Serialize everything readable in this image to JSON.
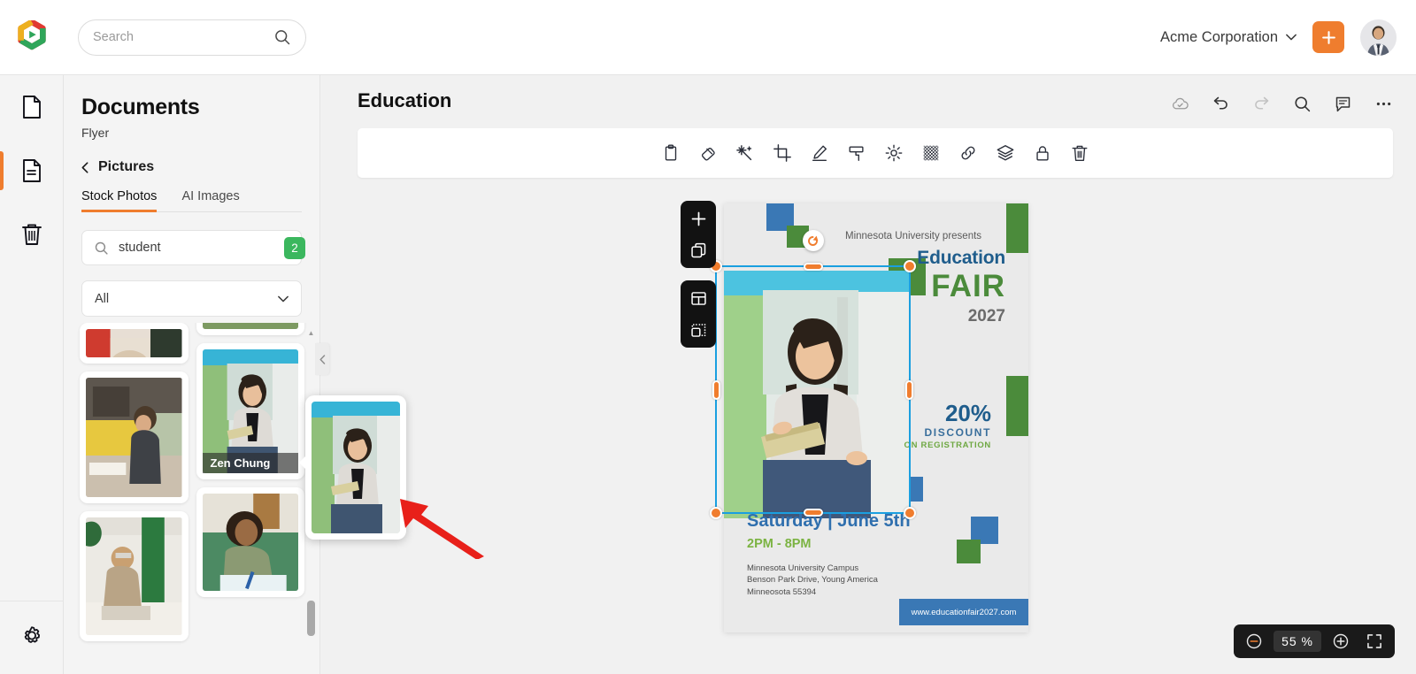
{
  "app": {
    "logo_name": "brand-logo"
  },
  "topbar": {
    "search_placeholder": "Search",
    "org_name": "Acme Corporation",
    "add_label": "+"
  },
  "rail": {
    "items": [
      {
        "name": "documents",
        "icon": "file-icon",
        "active": false
      },
      {
        "name": "pages",
        "icon": "file-lines-icon",
        "active": true
      },
      {
        "name": "trash",
        "icon": "trash-icon",
        "active": false
      }
    ],
    "settings": {
      "name": "settings",
      "icon": "gear-icon"
    }
  },
  "panel": {
    "title": "Documents",
    "subtitle": "Flyer",
    "breadcrumb": "Pictures",
    "tabs": [
      {
        "label": "Stock Photos",
        "active": true
      },
      {
        "label": "AI Images",
        "active": false
      }
    ],
    "filter": {
      "value": "student",
      "count_badge": "2"
    },
    "category": {
      "value": "All"
    },
    "thumbnails": [
      {
        "id": "t1",
        "label": ""
      },
      {
        "id": "t2",
        "label": ""
      },
      {
        "id": "t3",
        "label": ""
      },
      {
        "id": "t4",
        "label": "Zen Chung"
      },
      {
        "id": "t5",
        "label": ""
      },
      {
        "id": "t6",
        "label": ""
      }
    ],
    "preview_label": "Zen Chung"
  },
  "main": {
    "doc_title": "Education",
    "actions": [
      {
        "name": "cloud-saved-icon",
        "label": "Saved"
      },
      {
        "name": "undo-icon",
        "label": "Undo"
      },
      {
        "name": "redo-icon",
        "label": "Redo"
      },
      {
        "name": "search-icon",
        "label": "Find"
      },
      {
        "name": "comment-icon",
        "label": "Comments"
      },
      {
        "name": "more-icon",
        "label": "More"
      }
    ],
    "toolbar": [
      {
        "name": "clipboard-icon",
        "label": "Paste"
      },
      {
        "name": "eraser-icon",
        "label": "Erase"
      },
      {
        "name": "magic-wand-icon",
        "label": "Magic"
      },
      {
        "name": "crop-icon",
        "label": "Crop"
      },
      {
        "name": "pen-icon",
        "label": "Draw"
      },
      {
        "name": "paint-roller-icon",
        "label": "Fill"
      },
      {
        "name": "brightness-icon",
        "label": "Adjust"
      },
      {
        "name": "transparency-icon",
        "label": "Transparency"
      },
      {
        "name": "link-icon",
        "label": "Link"
      },
      {
        "name": "layers-icon",
        "label": "Layers"
      },
      {
        "name": "lock-icon",
        "label": "Lock"
      },
      {
        "name": "trash-icon",
        "label": "Delete"
      }
    ],
    "float_tools": [
      {
        "name": "add-icon",
        "label": "Add"
      },
      {
        "name": "duplicate-icon",
        "label": "Duplicate"
      },
      {
        "name": "grid-icon",
        "label": "Grid"
      },
      {
        "name": "placeholder-icon",
        "label": "Placeholder"
      }
    ],
    "zoom": {
      "value": "55",
      "unit": "%",
      "minus": "zoom-out-icon",
      "plus": "zoom-in-icon",
      "fullscreen": "fullscreen-icon"
    }
  },
  "flyer": {
    "presents": "Minnesota University presents",
    "heading": "Education",
    "fair": "FAIR",
    "year": "2027",
    "discount_pct": "20%",
    "discount_word": "DISCOUNT",
    "discount_sub": "ON REGISTRATION",
    "date": "Saturday | June 5th",
    "time": "2PM - 8PM",
    "address": "Minnesota University Campus\nBenson Park Drive, Young America\nMinneosota 55394",
    "url": "www.educationfair2027.com",
    "colors": {
      "blue": "#3a78b5",
      "green": "#4b8b3b",
      "title_blue": "#1f5d8c",
      "accent_orange": "#f07d2e",
      "selection_blue": "#1a9fe0"
    }
  }
}
